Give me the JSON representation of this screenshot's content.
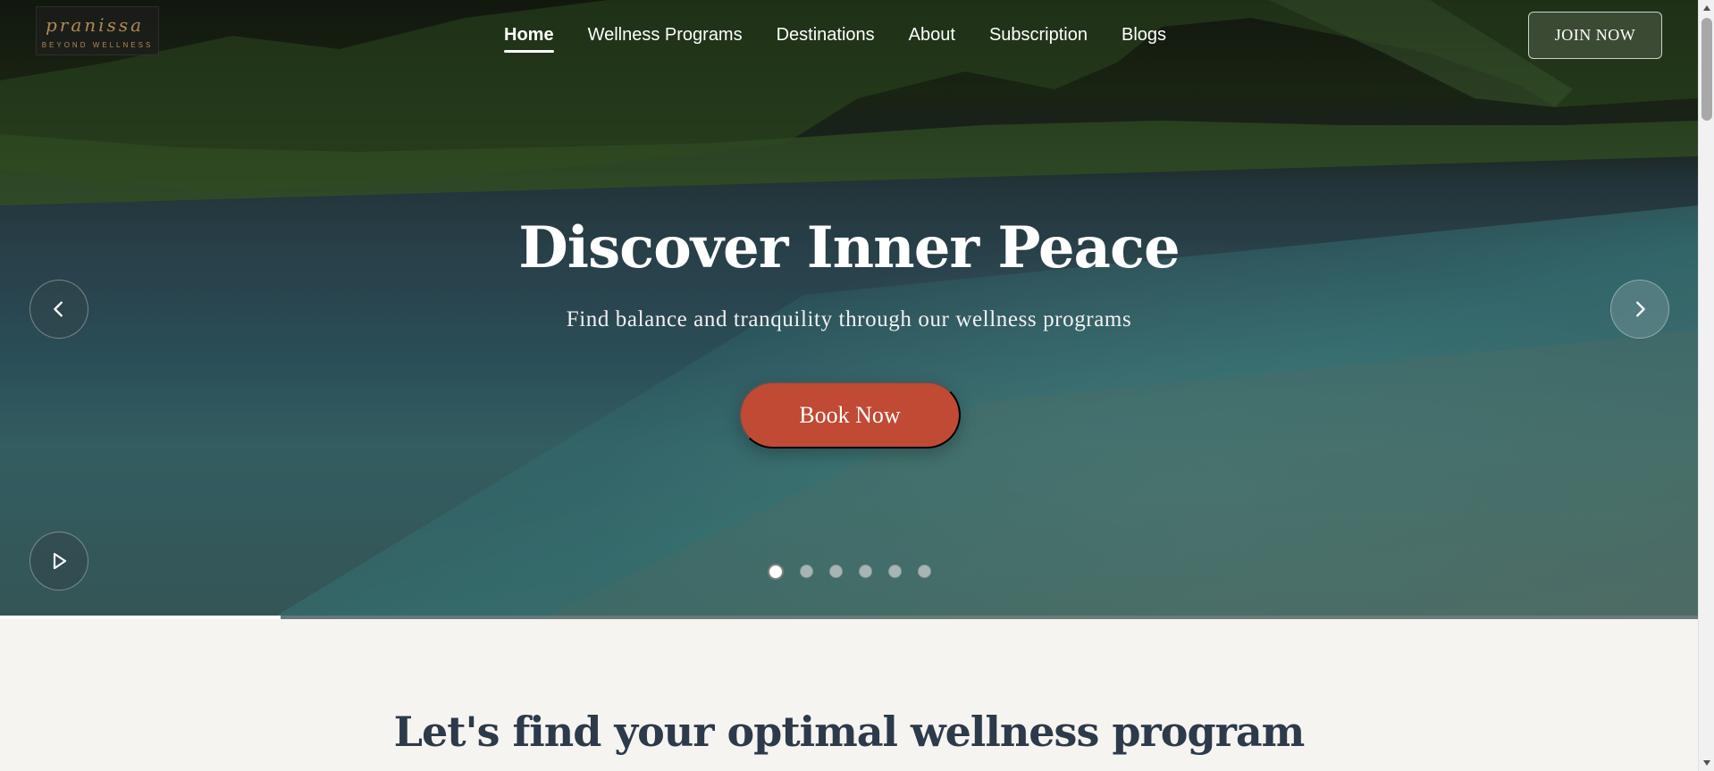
{
  "brand": {
    "logo_script": "pranissa",
    "logo_tagline": "BEYOND WELLNESS"
  },
  "nav": {
    "items": [
      {
        "label": "Home",
        "active": true
      },
      {
        "label": "Wellness Programs",
        "active": false
      },
      {
        "label": "Destinations",
        "active": false
      },
      {
        "label": "About",
        "active": false
      },
      {
        "label": "Subscription",
        "active": false
      },
      {
        "label": "Blogs",
        "active": false
      }
    ],
    "join_label": "JOIN NOW"
  },
  "hero": {
    "title": "Discover Inner Peace",
    "subtitle": "Find balance and tranquility through our wellness programs",
    "cta_label": "Book Now",
    "slide_count": 6,
    "active_slide": 1,
    "progress_fraction": 0.165,
    "icons": {
      "prev": "chevron-left-icon",
      "next": "chevron-right-icon",
      "play": "play-icon"
    }
  },
  "section": {
    "title": "Let's find your optimal wellness program"
  },
  "colors": {
    "accent": "#c04a33",
    "heading": "#2c3a4a",
    "background": "#f6f4f0"
  }
}
